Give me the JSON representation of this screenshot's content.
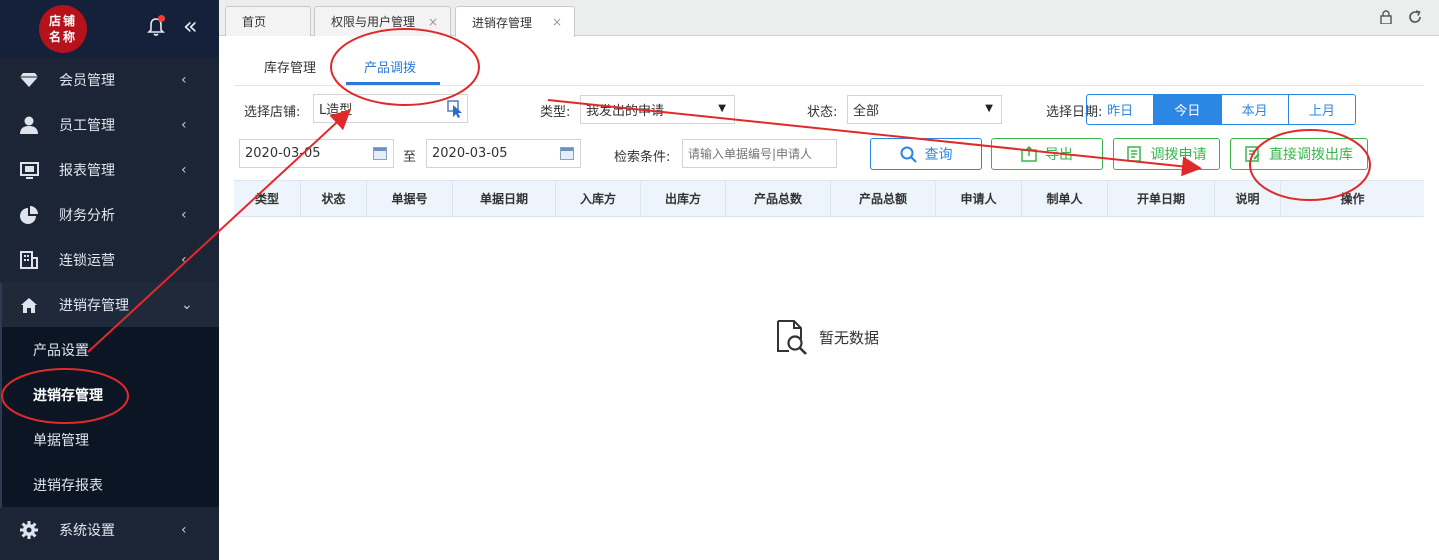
{
  "sidebar": {
    "logo_line1": "店铺",
    "logo_line2": "名称",
    "collapse_icon": "«",
    "items": [
      {
        "label": "会员管理",
        "icon": "diamond-icon",
        "arrow": "‹"
      },
      {
        "label": "员工管理",
        "icon": "user-icon",
        "arrow": "‹"
      },
      {
        "label": "报表管理",
        "icon": "monitor-icon",
        "arrow": "‹"
      },
      {
        "label": "财务分析",
        "icon": "pie-chart-icon",
        "arrow": "‹"
      },
      {
        "label": "连锁运营",
        "icon": "building-icon",
        "arrow": "‹"
      },
      {
        "label": "进销存管理",
        "icon": "home-icon",
        "arrow": "⌄"
      },
      {
        "label": "系统设置",
        "icon": "gear-icon",
        "arrow": "‹"
      }
    ],
    "subitems": [
      {
        "label": "产品设置"
      },
      {
        "label": "进销存管理"
      },
      {
        "label": "单据管理"
      },
      {
        "label": "进销存报表"
      }
    ]
  },
  "tabs": [
    {
      "label": "首页"
    },
    {
      "label": "权限与用户管理",
      "close": "×"
    },
    {
      "label": "进销存管理",
      "close": "×"
    }
  ],
  "subtabs": [
    {
      "label": "库存管理"
    },
    {
      "label": "产品调拨"
    }
  ],
  "filters": {
    "store_label": "选择店铺:",
    "store_value": "L造型",
    "type_label": "类型:",
    "type_value": "我发出的申请",
    "status_label": "状态:",
    "status_value": "全部",
    "date_label": "选择日期:",
    "date_options": [
      "昨日",
      "今日",
      "本月",
      "上月"
    ],
    "date_selected": "今日",
    "date_from": "2020-03-05",
    "date_sep": "至",
    "date_to": "2020-03-05",
    "search_label": "检索条件:",
    "search_placeholder": "请输入单据编号|申请人"
  },
  "buttons": {
    "query": "查询",
    "export": "导出",
    "transfer_request": "调拨申请",
    "direct_transfer_out": "直接调拨出库"
  },
  "table": {
    "columns": [
      "类型",
      "状态",
      "单据号",
      "单据日期",
      "入库方",
      "出库方",
      "产品总数",
      "产品总额",
      "申请人",
      "制单人",
      "开单日期",
      "说明",
      "操作"
    ]
  },
  "empty_text": "暂无数据",
  "colors": {
    "sidebar_bg": "#1c2535",
    "accent_blue": "#2b87e3",
    "accent_green": "#3ab54a",
    "annotation_red": "#e02a2a",
    "logo_red": "#b5121b"
  }
}
